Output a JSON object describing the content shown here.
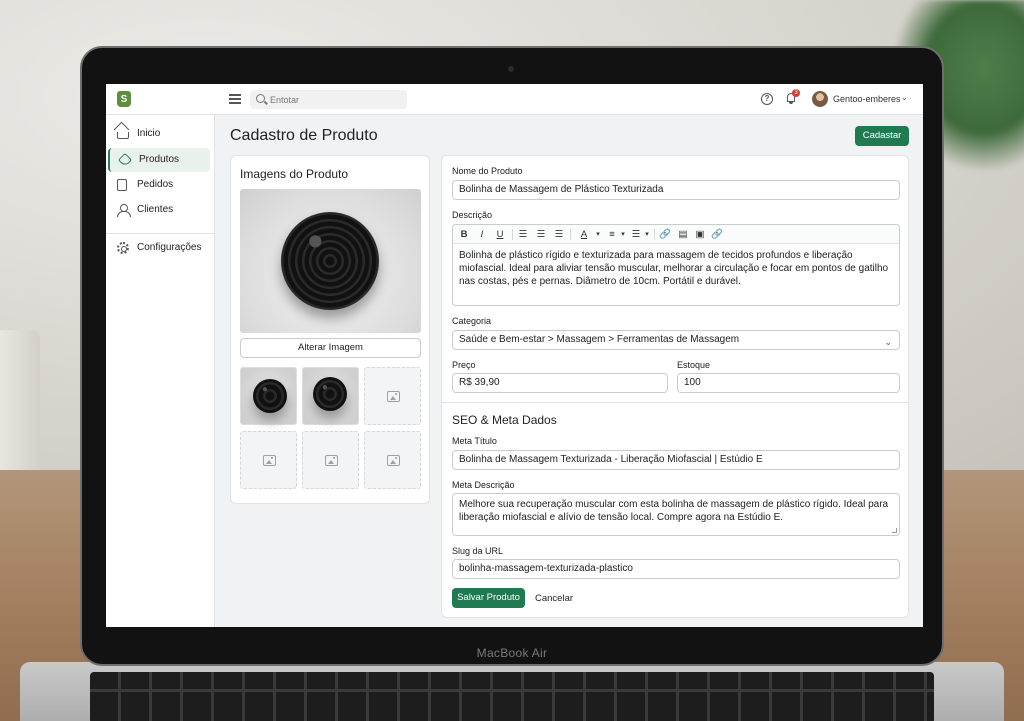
{
  "device": {
    "model_label": "MacBook Air"
  },
  "topbar": {
    "search_placeholder": "Entotar",
    "notification_count": "3",
    "user_name": "Gentoo-emberes"
  },
  "sidebar": {
    "items": [
      {
        "label": "Inicio",
        "icon": "home-icon"
      },
      {
        "label": "Produtos",
        "icon": "tag-icon",
        "active": true
      },
      {
        "label": "Pedidos",
        "icon": "clipboard-icon"
      },
      {
        "label": "Clientes",
        "icon": "user-icon"
      },
      {
        "label": "Configurações",
        "icon": "gear-icon"
      }
    ]
  },
  "page": {
    "title": "Cadastro de Produto",
    "primary_action": "Cadastar"
  },
  "images": {
    "title": "Imagens do Produto",
    "change_button": "Alterar Imagem"
  },
  "form": {
    "name_label": "Nome do Produto",
    "name_value": "Bolinha de Massagem de Plástico Texturizada",
    "description_label": "Descrição",
    "toolbar": {
      "bold": "B",
      "italic": "I",
      "underline": "U",
      "text_color": "A"
    },
    "description_value": "Bolinha de plástico rígido e texturizada para massagem de tecidos profundos e liberação miofascial. Ideal para aliviar tensão muscular, melhorar a circulação e focar em pontos de gatilho nas costas, pés e pernas. Diâmetro de 10cm. Portátil e durável.",
    "category_label": "Categoria",
    "category_value": "Saúde e Bem-estar > Massagem > Ferramentas de Massagem",
    "price_label": "Preço",
    "price_value": "R$ 39,90",
    "stock_label": "Estoque",
    "stock_value": "100"
  },
  "seo": {
    "title": "SEO & Meta Dados",
    "meta_title_label": "Meta Título",
    "meta_title_value": "Bolinha de Massagem Texturizada - Liberação Miofascial | Estúdio E",
    "meta_description_label": "Meta Descrição",
    "meta_description_value": "Melhore sua recuperação muscular com esta bolinha de massagem de plástico rígido. Ideal para liberação miofascial e alívio de tensão local. Compre agora na Estúdio E.",
    "slug_label": "Slug da URL",
    "slug_value": "bolinha-massagem-texturizada-plastico"
  },
  "actions": {
    "save": "Salvar Produto",
    "cancel": "Cancelar"
  },
  "colors": {
    "accent": "#1f7a52",
    "active_nav_bg": "#e9f1ec",
    "badge": "#d83b2d"
  }
}
